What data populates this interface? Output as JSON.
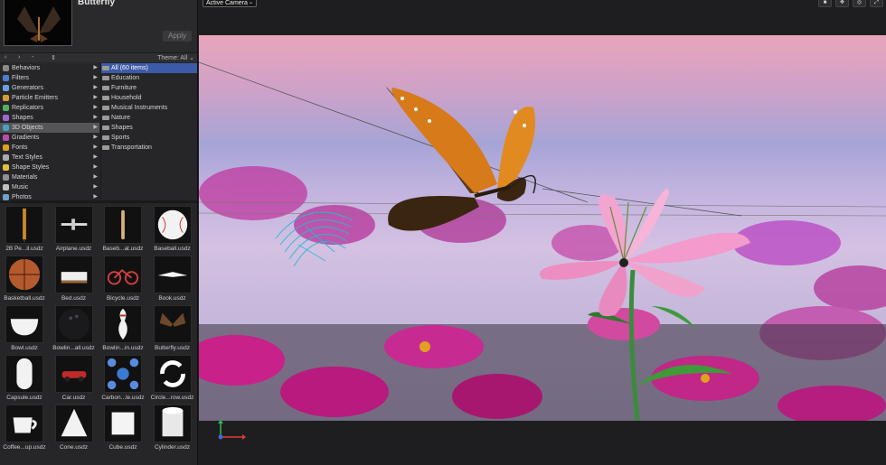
{
  "preview": {
    "title": "Butterfly",
    "apply_label": "Apply"
  },
  "nav": {
    "back": "‹",
    "forward": "›",
    "dash": "-",
    "updown": "⇕",
    "theme": "Theme: All ⌄"
  },
  "categories": [
    {
      "label": "Behaviors",
      "icon": "behaviors-icon",
      "color": "#8a8a8a"
    },
    {
      "label": "Filters",
      "icon": "filters-icon",
      "color": "#4a7fd0"
    },
    {
      "label": "Generators",
      "icon": "generators-icon",
      "color": "#6aa0e0"
    },
    {
      "label": "Particle Emitters",
      "icon": "particle-emitters-icon",
      "color": "#d79a3a"
    },
    {
      "label": "Replicators",
      "icon": "replicators-icon",
      "color": "#50b060"
    },
    {
      "label": "Shapes",
      "icon": "shapes-icon",
      "color": "#9a6ad0"
    },
    {
      "label": "3D Objects",
      "icon": "3d-objects-icon",
      "color": "#4aa0c0",
      "selected": true
    },
    {
      "label": "Gradients",
      "icon": "gradients-icon",
      "color": "#c04ab0"
    },
    {
      "label": "Fonts",
      "icon": "fonts-icon",
      "color": "#e0a020"
    },
    {
      "label": "Text Styles",
      "icon": "text-styles-icon",
      "color": "#aaaaaa"
    },
    {
      "label": "Shape Styles",
      "icon": "shape-styles-icon",
      "color": "#e0c040"
    },
    {
      "label": "Materials",
      "icon": "materials-icon",
      "color": "#909090"
    },
    {
      "label": "Music",
      "icon": "music-icon",
      "color": "#c0c0c0"
    },
    {
      "label": "Photos",
      "icon": "photos-icon",
      "color": "#70a0d0"
    }
  ],
  "subcategories": [
    {
      "label": "All (60 items)",
      "selected": true
    },
    {
      "label": "Education"
    },
    {
      "label": "Furniture"
    },
    {
      "label": "Household"
    },
    {
      "label": "Musical Instruments"
    },
    {
      "label": "Nature"
    },
    {
      "label": "Shapes"
    },
    {
      "label": "Sports"
    },
    {
      "label": "Transportation"
    }
  ],
  "items": [
    {
      "label": "2B Pe...il.usdz",
      "icon": "pencil-icon"
    },
    {
      "label": "Airplane.usdz",
      "icon": "airplane-icon"
    },
    {
      "label": "Baseb...at.usdz",
      "icon": "baseball-bat-icon"
    },
    {
      "label": "Baseball.usdz",
      "icon": "baseball-icon"
    },
    {
      "label": "Basketball.usdz",
      "icon": "basketball-icon"
    },
    {
      "label": "Bed.usdz",
      "icon": "bed-icon"
    },
    {
      "label": "Bicycle.usdz",
      "icon": "bicycle-icon"
    },
    {
      "label": "Book.usdz",
      "icon": "book-icon"
    },
    {
      "label": "Bowl.usdz",
      "icon": "bowl-icon"
    },
    {
      "label": "Bowlin...all.usdz",
      "icon": "bowling-ball-icon"
    },
    {
      "label": "Bowlin...in.usdz",
      "icon": "bowling-pin-icon"
    },
    {
      "label": "Butterfly.usdz",
      "icon": "butterfly-icon"
    },
    {
      "label": "Capsule.usdz",
      "icon": "capsule-icon"
    },
    {
      "label": "Car.usdz",
      "icon": "car-icon"
    },
    {
      "label": "Carbon...le.usdz",
      "icon": "carbon-molecule-icon"
    },
    {
      "label": "Circle...row.usdz",
      "icon": "circle-arrow-icon"
    },
    {
      "label": "Coffee...up.usdz",
      "icon": "coffee-cup-icon"
    },
    {
      "label": "Cone.usdz",
      "icon": "cone-icon"
    },
    {
      "label": "Cube.usdz",
      "icon": "cube-icon"
    },
    {
      "label": "Cylinder.usdz",
      "icon": "cylinder-icon"
    }
  ],
  "viewer": {
    "camera_label": "Active Camera",
    "tools": [
      "■",
      "✥",
      "◎",
      "⤢"
    ]
  }
}
